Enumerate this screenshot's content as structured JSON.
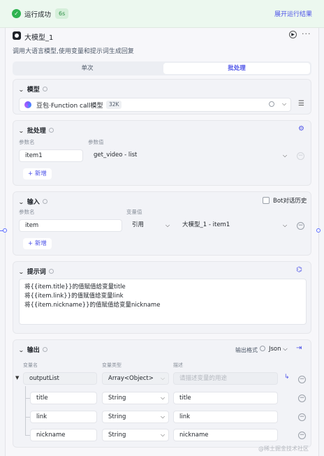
{
  "top": {
    "status": "运行成功",
    "time": "6s",
    "expand": "展开运行结果"
  },
  "node": {
    "title": "大模型_1",
    "description": "调用大语言模型,使用变量和提示词生成回复"
  },
  "tabs": {
    "single": "单次",
    "batch": "批处理"
  },
  "model": {
    "title": "模型",
    "name": "豆包·Function call模型",
    "context": "32K"
  },
  "batch": {
    "title": "批处理",
    "param_name_label": "参数名",
    "param_value_label": "参数值",
    "param_name": "item1",
    "param_value": "get_video - list",
    "add_label": "新增"
  },
  "input": {
    "title": "输入",
    "bot_history": "Bot对话历史",
    "param_name_label": "参数名",
    "var_value_label": "变量值",
    "param_name": "item",
    "ref_type": "引用",
    "ref_value": "大模型_1 - item1",
    "add_label": "新增"
  },
  "prompt": {
    "title": "提示词",
    "lines": [
      "将{{item.title}}的值赋值给变量title",
      "将{{item.link}}的值赋值给变量link",
      "将{{item.nickname}}的值赋值给变量nickname"
    ]
  },
  "output": {
    "title": "输出",
    "format_label": "输出格式",
    "format_value": "Json",
    "var_name_label": "变量名",
    "var_type_label": "变量类型",
    "desc_label": "描述",
    "root": {
      "name": "outputList",
      "type": "Array<Object>",
      "desc_placeholder": "请描述变量的用途"
    },
    "children": [
      {
        "name": "title",
        "type": "String",
        "desc": "title"
      },
      {
        "name": "link",
        "type": "String",
        "desc": "link"
      },
      {
        "name": "nickname",
        "type": "String",
        "desc": "nickname"
      }
    ]
  },
  "watermark": "@稀土掘金技术社区"
}
